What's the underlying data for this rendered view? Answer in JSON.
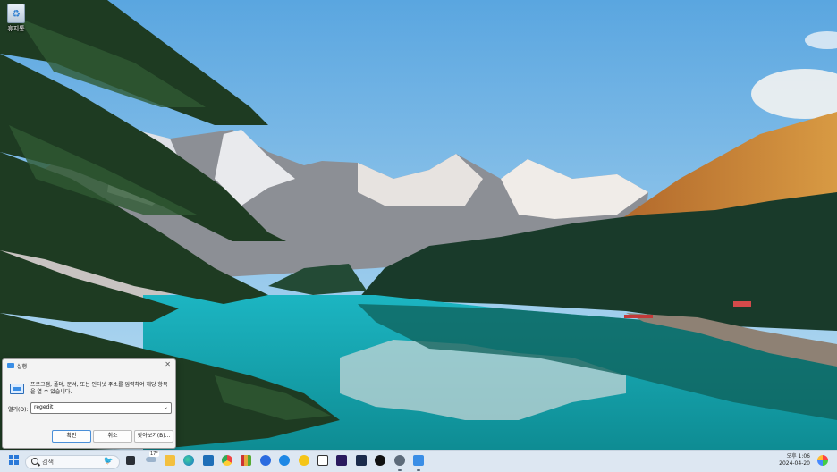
{
  "desktop": {
    "recycle_bin_label": "휴지통",
    "recycle_bin_icon": "recycle-bin-icon"
  },
  "run_dialog": {
    "title": "실행",
    "description": "프로그램, 폴더, 문서, 또는 인터넷 주소를 입력하여 해당 항목을 열 수 있습니다.",
    "open_label": "열기(O):",
    "open_value": "regedit",
    "ok_label": "확인",
    "cancel_label": "취소",
    "browse_label": "찾아보기(B)...",
    "close_glyph": "✕"
  },
  "taskbar": {
    "search_placeholder": "검색",
    "weather_temp": "17°",
    "clock_time": "오후 1:06",
    "clock_date": "2024-04-20",
    "pinned_apps": [
      "task-view-icon",
      "widgets-icon",
      "file-explorer-icon",
      "edge-icon",
      "calculator-icon",
      "chrome-icon",
      "winrar-icon",
      "app-icon",
      "app-icon",
      "app-icon",
      "notion-icon",
      "premiere-pro-icon",
      "app-icon",
      "app-icon",
      "settings-icon",
      "run-icon"
    ]
  }
}
